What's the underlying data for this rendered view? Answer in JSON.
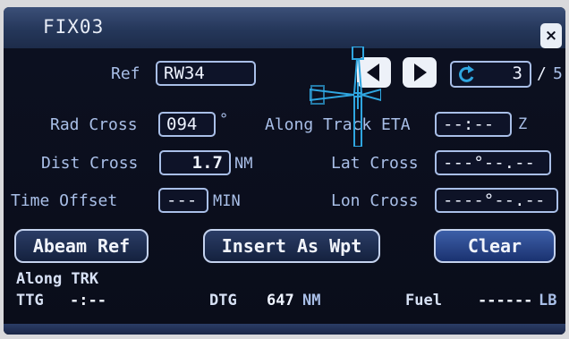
{
  "window": {
    "title": "FIX03",
    "close_label": "×"
  },
  "ref": {
    "label": "Ref",
    "value": "RW34"
  },
  "pager": {
    "current": "3",
    "separator": "/",
    "total": "5"
  },
  "rad_cross": {
    "label": "Rad Cross",
    "value": "094",
    "unit": "°"
  },
  "dist_cross": {
    "label": "Dist Cross",
    "value": "1.7",
    "unit": "NM"
  },
  "time_offset": {
    "label": "Time Offset",
    "value": "---",
    "unit": "MIN"
  },
  "along_track_eta": {
    "label": "Along Track ETA",
    "value": "--:--",
    "unit": "Z"
  },
  "lat_cross": {
    "label": "Lat Cross",
    "value": "---°--.--"
  },
  "lon_cross": {
    "label": "Lon Cross",
    "value": "----°--.--"
  },
  "buttons": {
    "abeam_ref": "Abeam Ref",
    "insert_as_wpt": "Insert As Wpt",
    "clear": "Clear"
  },
  "footer": {
    "section_title": "Along TRK",
    "ttg_label": "TTG",
    "ttg_value": "-:--",
    "dtg_label": "DTG",
    "dtg_value": "647",
    "dtg_unit": "NM",
    "fuel_label": "Fuel",
    "fuel_value": "------",
    "fuel_unit": "LB"
  },
  "colors": {
    "label": "#a9bfe8",
    "value": "#eef3ff",
    "cursor": "#2fa6e0"
  },
  "icons": [
    "close-icon",
    "arrow-left-icon",
    "arrow-right-icon",
    "refresh-icon",
    "cursor-crosshair-icon"
  ]
}
